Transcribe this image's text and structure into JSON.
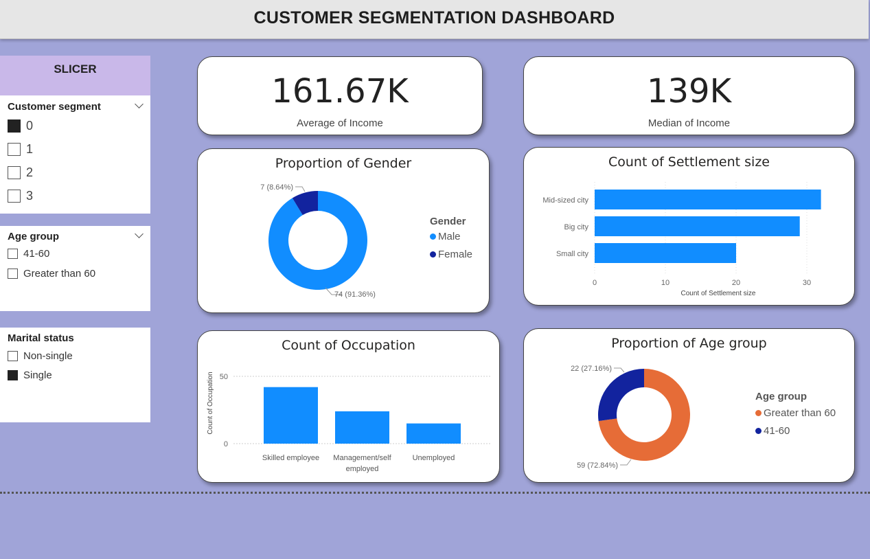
{
  "header": {
    "title": "CUSTOMER SEGMENTATION DASHBOARD"
  },
  "slicer": {
    "title": "SLICER",
    "customer_segment": {
      "title": "Customer segment",
      "options": [
        {
          "label": "0",
          "checked": true
        },
        {
          "label": "1",
          "checked": false
        },
        {
          "label": "2",
          "checked": false
        },
        {
          "label": "3",
          "checked": false
        }
      ]
    },
    "age_group": {
      "title": "Age group",
      "options": [
        {
          "label": "41-60",
          "checked": false
        },
        {
          "label": "Greater than 60",
          "checked": false
        }
      ]
    },
    "marital_status": {
      "title": "Marital status",
      "options": [
        {
          "label": "Non-single",
          "checked": false
        },
        {
          "label": "Single",
          "checked": true
        }
      ]
    }
  },
  "kpis": {
    "average": {
      "value": "161.67K",
      "label": "Average of Income"
    },
    "median": {
      "value": "139K",
      "label": "Median of Income"
    }
  },
  "colors": {
    "primary_blue": "#118dff",
    "dark_blue": "#12239e",
    "orange": "#e66c37",
    "background": "#a0a4d8",
    "slicer_header": "#c9b8e9"
  },
  "chart_data": [
    {
      "id": "gender",
      "type": "pie",
      "title": "Proportion of Gender",
      "legend_title": "Gender",
      "slices": [
        {
          "name": "Male",
          "value": 74,
          "label": "74 (91.36%)",
          "color": "#118dff"
        },
        {
          "name": "Female",
          "value": 7,
          "label": "7 (8.64%)",
          "color": "#12239e"
        }
      ]
    },
    {
      "id": "settlement",
      "type": "bar",
      "orientation": "horizontal",
      "title": "Count of Settlement size",
      "categories": [
        "Mid-sized city",
        "Big city",
        "Small city"
      ],
      "values": [
        32,
        29,
        20
      ],
      "xlabel": "Count of Settlement size",
      "ylabel": "",
      "xlim": [
        0,
        35
      ],
      "ticks": [
        "0",
        "10",
        "20",
        "30"
      ],
      "color": "#118dff",
      "grid": true
    },
    {
      "id": "occupation",
      "type": "bar",
      "title": "Count of Occupation",
      "categories": [
        "Skilled employee",
        "Management/self employed",
        "Unemployed"
      ],
      "values": [
        42,
        24,
        15
      ],
      "xlabel": "",
      "ylabel": "Count of Occupation",
      "ylim": [
        0,
        50
      ],
      "ticks": [
        "0",
        "50"
      ],
      "color": "#118dff",
      "grid": true
    },
    {
      "id": "agegroup",
      "type": "pie",
      "title": "Proportion of Age group",
      "legend_title": "Age group",
      "slices": [
        {
          "name": "Greater than 60",
          "value": 59,
          "label": "59 (72.84%)",
          "color": "#e66c37"
        },
        {
          "name": "41-60",
          "value": 22,
          "label": "22 (27.16%)",
          "color": "#12239e"
        }
      ]
    }
  ]
}
